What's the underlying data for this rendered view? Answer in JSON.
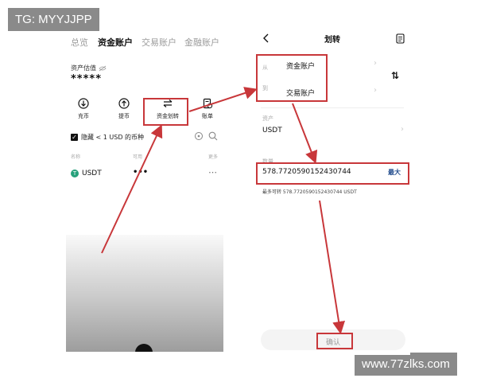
{
  "watermark": {
    "top_left": "TG: MYYJJPP",
    "bottom_right": "www.77zlks.com"
  },
  "left": {
    "tabs": [
      "总览",
      "资金账户",
      "交易账户",
      "金融账户"
    ],
    "valuation_label": "资产估值",
    "valuation_value": "*****",
    "actions": [
      {
        "label": "充币",
        "icon": "deposit-icon"
      },
      {
        "label": "提币",
        "icon": "withdraw-icon"
      },
      {
        "label": "资金划转",
        "icon": "transfer-icon"
      },
      {
        "label": "账单",
        "icon": "bill-icon"
      }
    ],
    "hide_small": "隐藏 < 1 USD 的币种",
    "columns": {
      "name": "名称",
      "available": "可用",
      "more": "更多"
    },
    "asset": {
      "symbol": "USDT",
      "available": "•••",
      "more": "⋯"
    }
  },
  "right": {
    "title": "划转",
    "from_label": "从",
    "from_account": "资金账户",
    "to_label": "到",
    "to_account": "交易账户",
    "swap_icon": "⇅",
    "asset_label": "资产",
    "asset_value": "USDT",
    "amount_label": "数量",
    "amount_value": "578.7720590152430744",
    "max_label": "最大",
    "max_available": "最多可转 578.7720590152430744 USDT",
    "confirm": "确认"
  },
  "colors": {
    "highlight": "#c8373a",
    "usdt": "#26a17b"
  }
}
